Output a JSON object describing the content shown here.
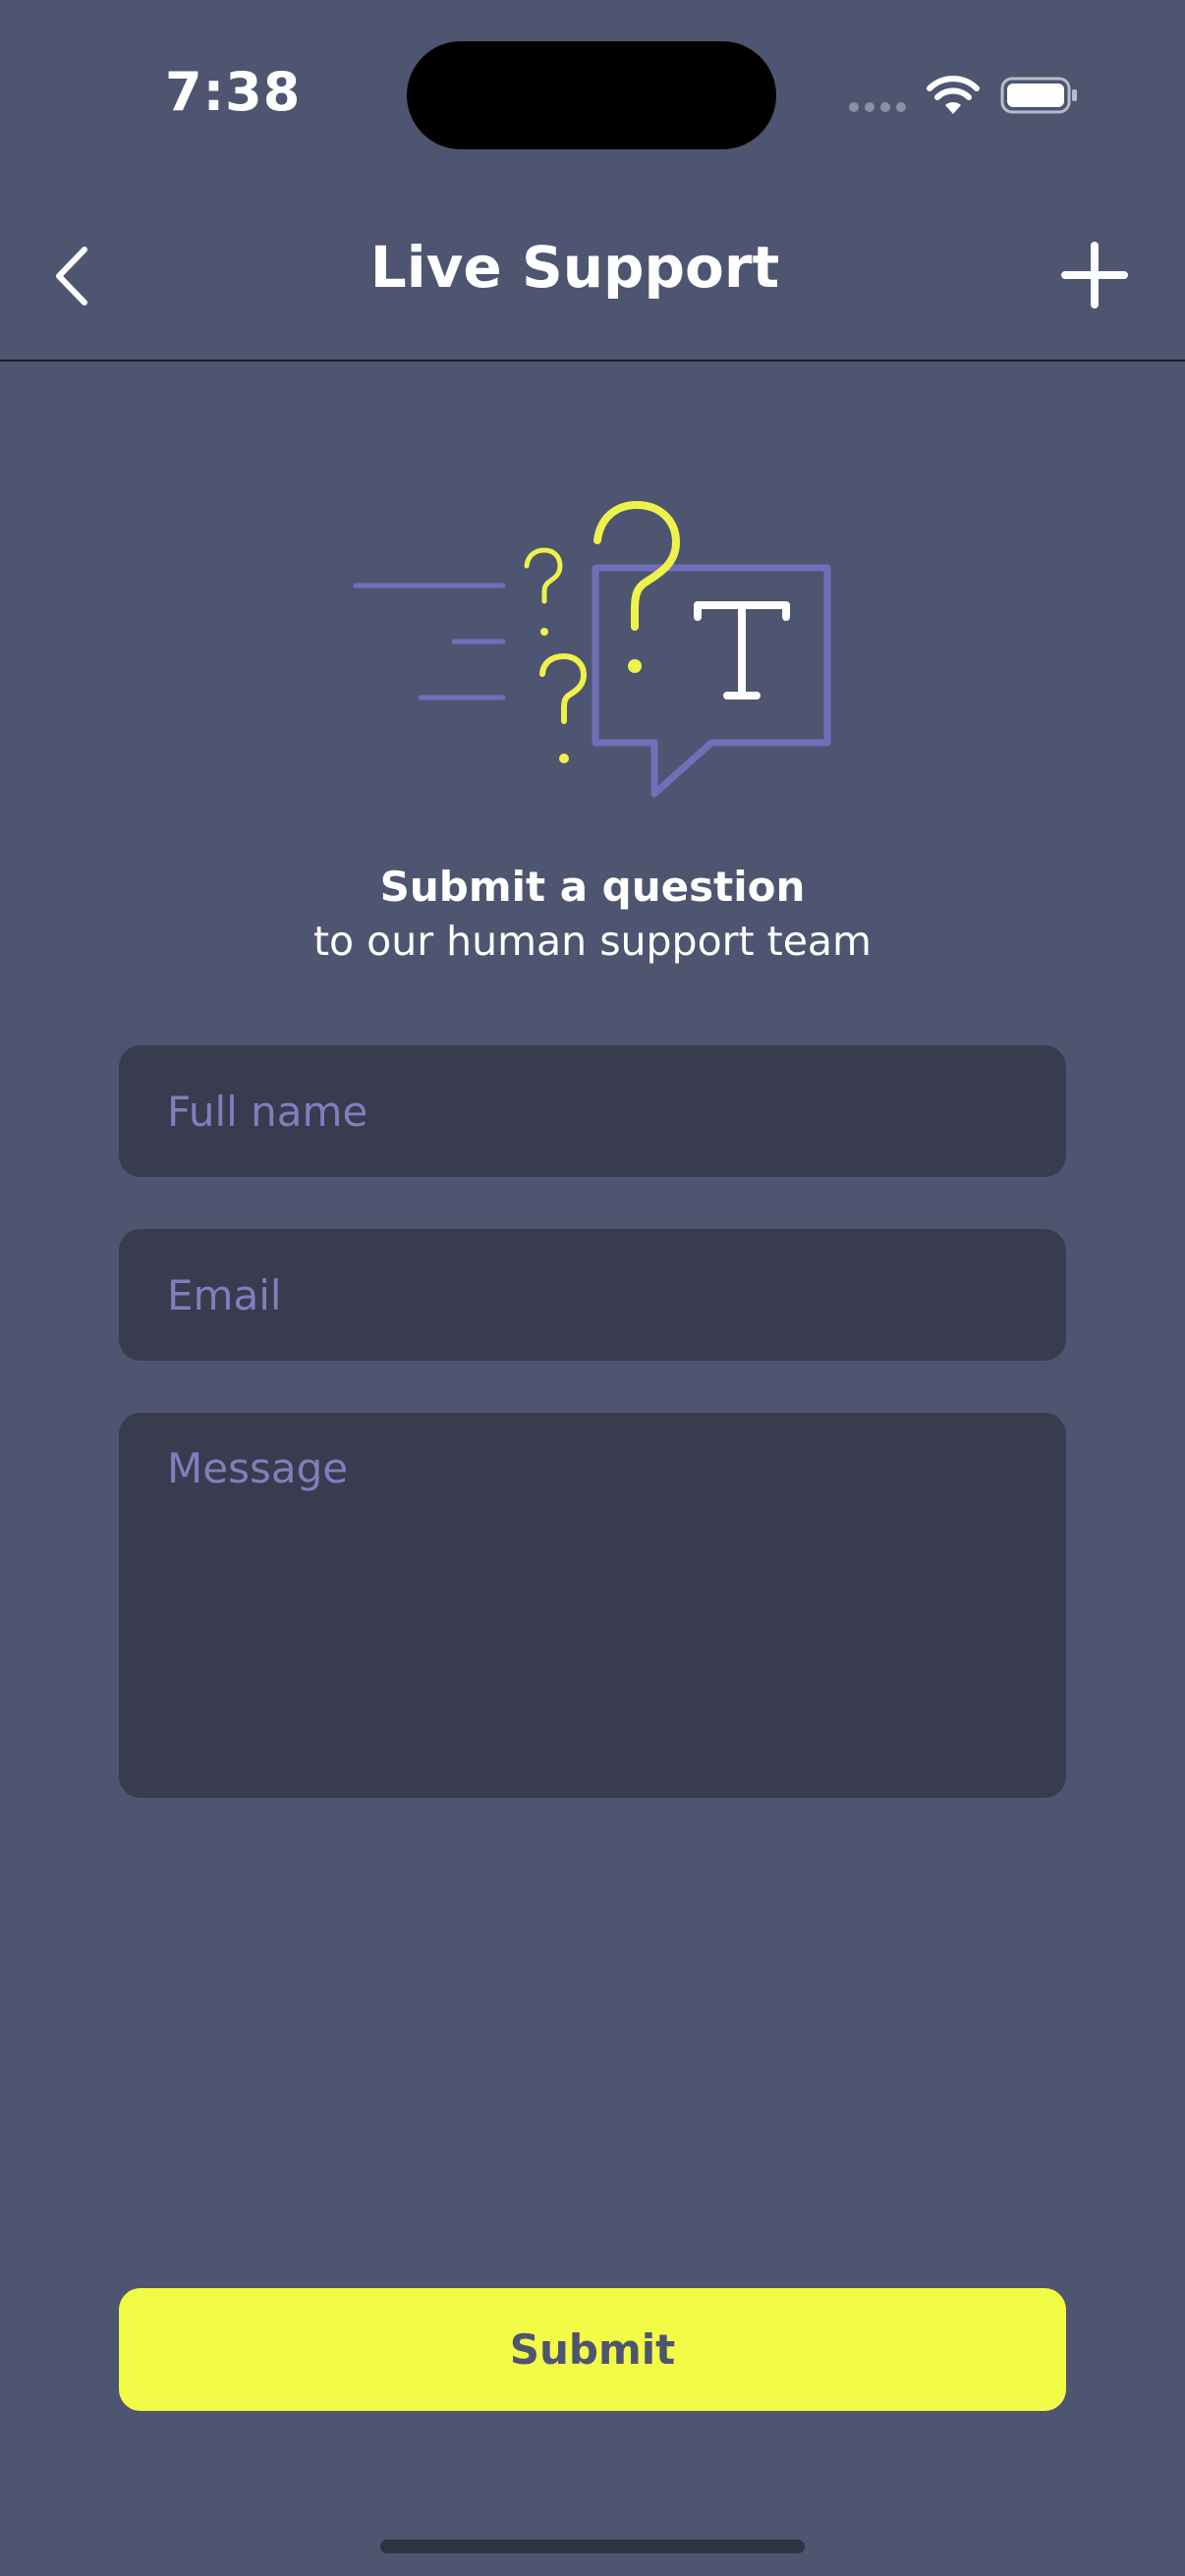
{
  "status_bar": {
    "time": "7:38"
  },
  "navbar": {
    "title": "Live Support",
    "back_icon": "chevron-left-icon",
    "add_icon": "plus-icon"
  },
  "intro": {
    "heading": "Submit a question",
    "subheading": "to our human support team"
  },
  "form": {
    "full_name_placeholder": "Full name",
    "email_placeholder": "Email",
    "message_placeholder": "Message",
    "submit_label": "Submit"
  },
  "colors": {
    "background": "#4e5570",
    "field_background": "#393b4f",
    "placeholder": "#7f7fbd",
    "accent": "#f2fb45",
    "illustration_purple": "#6f70b9",
    "illustration_yellow": "#eef24a"
  }
}
